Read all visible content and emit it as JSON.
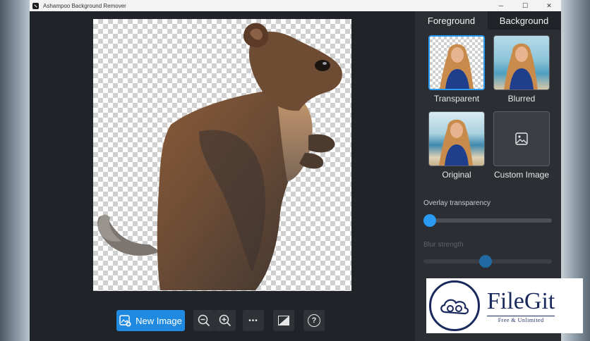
{
  "window": {
    "title": "Ashampoo Background Remover",
    "controls": {
      "minimize": "─",
      "maximize": "☐",
      "close": "✕"
    }
  },
  "toolbar": {
    "new_image_label": "New Image",
    "zoom_out_icon": "zoom-out-icon",
    "zoom_in_icon": "zoom-in-icon",
    "more_label": "•••",
    "compare_icon": "compare-icon",
    "help_label": "?"
  },
  "panel": {
    "tabs": [
      {
        "label": "Foreground"
      },
      {
        "label": "Background"
      }
    ],
    "options": [
      {
        "label": "Transparent",
        "selected": true
      },
      {
        "label": "Blurred",
        "selected": false
      },
      {
        "label": "Original",
        "selected": false
      },
      {
        "label": "Custom Image",
        "selected": false
      }
    ],
    "overlay": {
      "label": "Overlay transparency",
      "value": 0
    },
    "blur": {
      "label": "Blur strength",
      "value": 0.48,
      "enabled": false
    }
  },
  "colors": {
    "accent": "#1f8ae0",
    "panel_bg": "#2b2e33",
    "window_bg": "#202327"
  },
  "watermark": {
    "title": "FileGit",
    "subtitle": "Free & Unlimited"
  }
}
